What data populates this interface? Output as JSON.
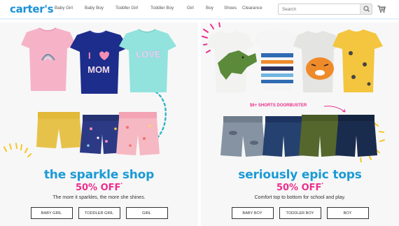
{
  "brand": {
    "logo_text": "carter's",
    "accent": "#1a90d8",
    "pink": "#ec2f8d"
  },
  "nav": [
    "Baby Girl",
    "Baby Boy",
    "Toddler Girl",
    "Toddler Boy",
    "Girl",
    "Boy",
    "Shoes",
    "Clearance"
  ],
  "search": {
    "placeholder": "Search",
    "icon": "search-icon"
  },
  "cart": {
    "icon": "shopping-cart-icon"
  },
  "left_panel": {
    "shirt_text_1": "MOM",
    "shirt_text_2": "LOVE",
    "headline": "the sparkle shop",
    "promo": "50% OFF",
    "promo_mark": "*",
    "tagline": "The more it sparkles, the more she shines.",
    "buttons": [
      "BABY GIRL",
      "TODDLER GIRL",
      "GIRL"
    ]
  },
  "right_panel": {
    "doorbuster": "$6+ SHORTS DOORBUSTER",
    "headline": "seriously epic tops",
    "promo": "50% OFF",
    "promo_mark": "*",
    "tagline": "Comfort top to bottom for school and play.",
    "buttons": [
      "BABY BOY",
      "TODDLER BOY",
      "BOY"
    ]
  }
}
